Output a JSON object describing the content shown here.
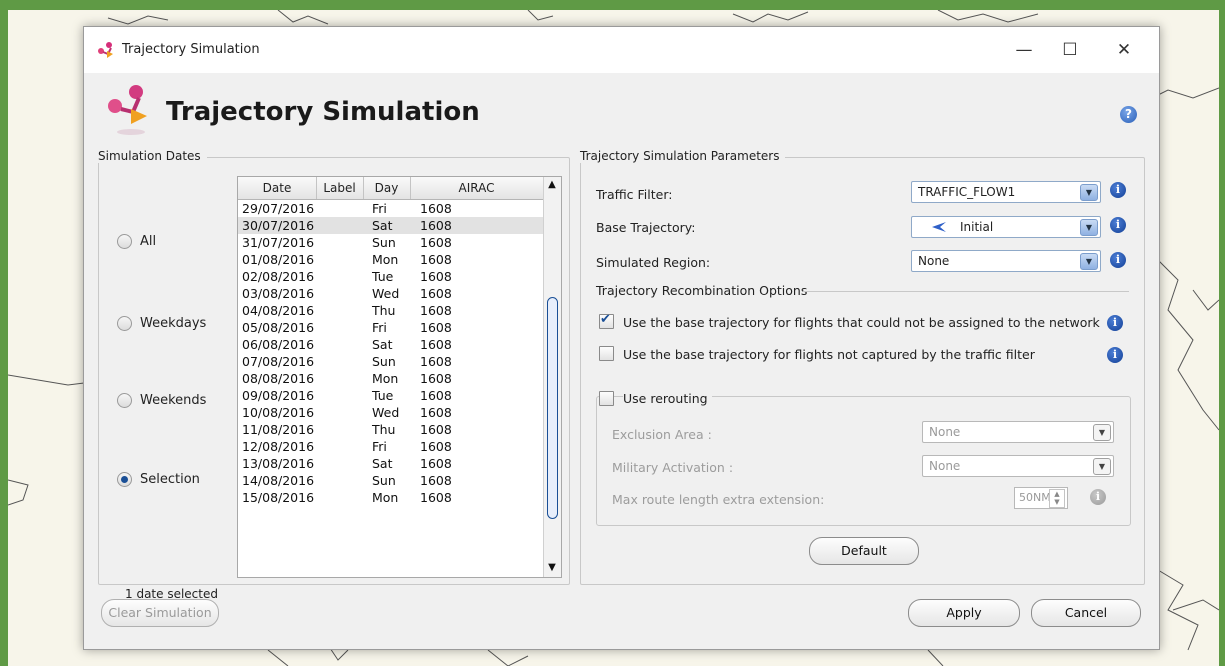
{
  "window": {
    "title": "Trajectory Simulation",
    "heading": "Trajectory Simulation",
    "controls": {
      "minimize": "—",
      "maximize": "☐",
      "close": "✕"
    },
    "help_glyph": "?"
  },
  "simulation_dates": {
    "group_title": "Simulation Dates",
    "options": [
      {
        "label": "All",
        "checked": false
      },
      {
        "label": "Weekdays",
        "checked": false
      },
      {
        "label": "Weekends",
        "checked": false
      },
      {
        "label": "Selection",
        "checked": true
      }
    ],
    "table": {
      "columns": [
        "Date",
        "Label",
        "Day",
        "AIRAC"
      ],
      "rows": [
        {
          "date": "29/07/2016",
          "label": "",
          "day": "Fri",
          "airac": "1608"
        },
        {
          "date": "30/07/2016",
          "label": "",
          "day": "Sat",
          "airac": "1608"
        },
        {
          "date": "31/07/2016",
          "label": "",
          "day": "Sun",
          "airac": "1608"
        },
        {
          "date": "01/08/2016",
          "label": "",
          "day": "Mon",
          "airac": "1608"
        },
        {
          "date": "02/08/2016",
          "label": "",
          "day": "Tue",
          "airac": "1608"
        },
        {
          "date": "03/08/2016",
          "label": "",
          "day": "Wed",
          "airac": "1608"
        },
        {
          "date": "04/08/2016",
          "label": "",
          "day": "Thu",
          "airac": "1608"
        },
        {
          "date": "05/08/2016",
          "label": "",
          "day": "Fri",
          "airac": "1608"
        },
        {
          "date": "06/08/2016",
          "label": "",
          "day": "Sat",
          "airac": "1608"
        },
        {
          "date": "07/08/2016",
          "label": "",
          "day": "Sun",
          "airac": "1608"
        },
        {
          "date": "08/08/2016",
          "label": "",
          "day": "Mon",
          "airac": "1608"
        },
        {
          "date": "09/08/2016",
          "label": "",
          "day": "Tue",
          "airac": "1608"
        },
        {
          "date": "10/08/2016",
          "label": "",
          "day": "Wed",
          "airac": "1608"
        },
        {
          "date": "11/08/2016",
          "label": "",
          "day": "Thu",
          "airac": "1608"
        },
        {
          "date": "12/08/2016",
          "label": "",
          "day": "Fri",
          "airac": "1608"
        },
        {
          "date": "13/08/2016",
          "label": "",
          "day": "Sat",
          "airac": "1608"
        },
        {
          "date": "14/08/2016",
          "label": "",
          "day": "Sun",
          "airac": "1608"
        },
        {
          "date": "15/08/2016",
          "label": "",
          "day": "Mon",
          "airac": "1608"
        }
      ],
      "selected_row": "30/07/2016"
    },
    "selected_count": "1 date selected"
  },
  "parameters": {
    "group_title": "Trajectory Simulation Parameters",
    "traffic_filter": {
      "label": "Traffic Filter:",
      "value": "TRAFFIC_FLOW1"
    },
    "base_trajectory": {
      "label": "Base Trajectory:",
      "value": "Initial"
    },
    "simulated_region": {
      "label": "Simulated Region:",
      "value": "None"
    },
    "recombination": {
      "title": "Trajectory Recombination Options",
      "opt1": {
        "label": "Use the base trajectory for flights that could not be assigned to the network",
        "checked": true
      },
      "opt2": {
        "label": "Use the base trajectory for flights not captured by the traffic filter",
        "checked": false
      }
    },
    "rerouting": {
      "label": "Use rerouting",
      "checked": false,
      "exclusion_area": {
        "label": "Exclusion Area :",
        "value": "None"
      },
      "military_activation": {
        "label": "Military Activation :",
        "value": "None"
      },
      "max_route": {
        "label": "Max route length extra extension:",
        "value": "50NM"
      }
    },
    "default_button": "Default"
  },
  "buttons": {
    "clear_simulation": "Clear Simulation",
    "apply": "Apply",
    "cancel": "Cancel"
  },
  "info_glyph": "i"
}
